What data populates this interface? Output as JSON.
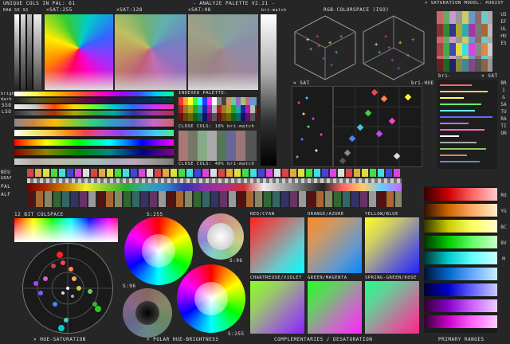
{
  "header": {
    "unique_cols": "UNIQUE COLS IN PAL: 61",
    "sat_255": "×SAT:255",
    "sat_128": "×SAT:128",
    "sat_48": "×SAT:48",
    "title": "- ANALYZE PALETTE V2.21 -",
    "bri_match": "bri-match",
    "rgb_space": "RGB-COLORSPACE (ISO)",
    "sat_model": "× SATURATION MODEL: PURIST",
    "unique_sub": "RAW  SO  SS",
    "raw_label": "RAW"
  },
  "left_labels": {
    "bright": "bright",
    "dark": "dark",
    "sso": "SSO",
    "lso": "LSO",
    "neu": "NEU",
    "gray": "GRAY",
    "pal": "PAL",
    "alf": "ALF"
  },
  "mid_panels": {
    "indexed": "INDEXED PALETTE:",
    "close_10": "CLOSE COLS: 10% bri-match",
    "close_40": "CLOSE COLS: 40% bri-match"
  },
  "scatter": {
    "sat_label": "× SAT",
    "bri_hue": "bri-HUE",
    "bri_right": "bri-",
    "sat_right": "× SAT"
  },
  "vertical": {
    "useful": "USEFUL HUES",
    "bri_sat": "BRI & SATURATION",
    "ramp": "ROYGBCBVM"
  },
  "bottom": {
    "bit12": "12 BIT COLSPACE",
    "s255a": "S:255",
    "s96a": "S:96",
    "s96b": "S:96",
    "s255b": "S:255",
    "red_cyan": "RED/CYAN",
    "orange_azure": "ORANGE/AZURE",
    "yellow_blue": "YELLOW/BLUE",
    "chartreuse": "CHARTREUSE/VIOLET",
    "green_magenta": "GREEN/MAGENTA",
    "spring_rose": "SPRING-GREEN/ROSE",
    "footer_hue_sat": "× HUE-SATURATION",
    "footer_polar": "× POLAR HUE-BRIGHTNESS",
    "footer_comp": "COMPLEMENTARIES / DESATURATION",
    "footer_primary": "PRIMARY RANGES"
  },
  "colors": {
    "bg": "#262626",
    "text": "#e0e0e0",
    "accent_yellow": "#f0e020"
  }
}
